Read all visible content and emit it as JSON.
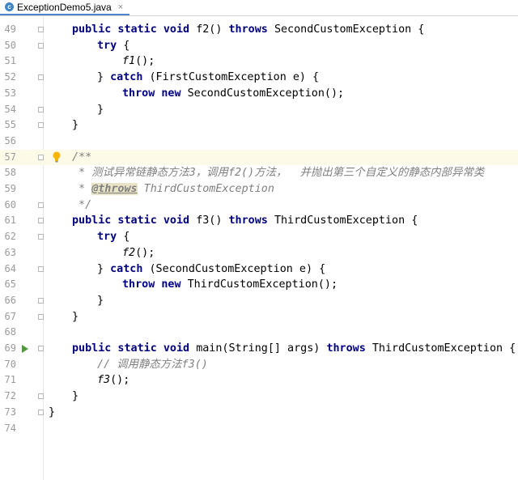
{
  "tab": {
    "icon": "java-class-icon",
    "icon_letter": "c",
    "title": "ExceptionDemo5.java",
    "close": "×"
  },
  "lines": [
    {
      "n": "49",
      "indent": 1,
      "parts": [
        [
          "kw",
          "public static void "
        ],
        [
          "",
          "f2() "
        ],
        [
          "kw",
          "throws "
        ],
        [
          "",
          "SecondCustomException {"
        ]
      ]
    },
    {
      "n": "50",
      "indent": 2,
      "parts": [
        [
          "kw",
          "try "
        ],
        [
          "",
          "{"
        ]
      ]
    },
    {
      "n": "51",
      "indent": 3,
      "parts": [
        [
          "it",
          "f1"
        ],
        [
          "",
          "();"
        ]
      ]
    },
    {
      "n": "52",
      "indent": 2,
      "parts": [
        [
          "",
          "} "
        ],
        [
          "kw",
          "catch "
        ],
        [
          "",
          "(FirstCustomException e) {"
        ]
      ]
    },
    {
      "n": "53",
      "indent": 3,
      "parts": [
        [
          "kw",
          "throw new "
        ],
        [
          "",
          "SecondCustomException();"
        ]
      ]
    },
    {
      "n": "54",
      "indent": 2,
      "parts": [
        [
          "",
          "}"
        ]
      ]
    },
    {
      "n": "55",
      "indent": 1,
      "parts": [
        [
          "",
          "}"
        ]
      ]
    },
    {
      "n": "56",
      "indent": 0,
      "parts": []
    },
    {
      "n": "57",
      "indent": 1,
      "current": true,
      "parts": [
        [
          "cm",
          "/**"
        ]
      ]
    },
    {
      "n": "58",
      "indent": 1,
      "parts": [
        [
          "cm",
          " * 测试异常链静态方法3，调用"
        ],
        [
          "cm",
          "f2()"
        ],
        [
          "cm",
          "方法，  并抛出第三个自定义的静态内部异常类"
        ]
      ]
    },
    {
      "n": "59",
      "indent": 1,
      "parts": [
        [
          "cm",
          " * "
        ],
        [
          "tag",
          "@throws"
        ],
        [
          "cm",
          " ThirdCustomException"
        ]
      ]
    },
    {
      "n": "60",
      "indent": 1,
      "parts": [
        [
          "cm",
          " */"
        ]
      ]
    },
    {
      "n": "61",
      "indent": 1,
      "parts": [
        [
          "kw",
          "public static void "
        ],
        [
          "",
          "f3() "
        ],
        [
          "kw",
          "throws "
        ],
        [
          "",
          "ThirdCustomException {"
        ]
      ]
    },
    {
      "n": "62",
      "indent": 2,
      "parts": [
        [
          "kw",
          "try "
        ],
        [
          "",
          "{"
        ]
      ]
    },
    {
      "n": "63",
      "indent": 3,
      "parts": [
        [
          "it",
          "f2"
        ],
        [
          "",
          "();"
        ]
      ]
    },
    {
      "n": "64",
      "indent": 2,
      "parts": [
        [
          "",
          "} "
        ],
        [
          "kw",
          "catch "
        ],
        [
          "",
          "(SecondCustomException e) {"
        ]
      ]
    },
    {
      "n": "65",
      "indent": 3,
      "parts": [
        [
          "kw",
          "throw new "
        ],
        [
          "",
          "ThirdCustomException();"
        ]
      ]
    },
    {
      "n": "66",
      "indent": 2,
      "parts": [
        [
          "",
          "}"
        ]
      ]
    },
    {
      "n": "67",
      "indent": 1,
      "parts": [
        [
          "",
          "}"
        ]
      ]
    },
    {
      "n": "68",
      "indent": 0,
      "parts": []
    },
    {
      "n": "69",
      "indent": 1,
      "run": true,
      "parts": [
        [
          "kw",
          "public static void "
        ],
        [
          "",
          "main(String[] args) "
        ],
        [
          "kw",
          "throws "
        ],
        [
          "",
          "ThirdCustomException {"
        ]
      ]
    },
    {
      "n": "70",
      "indent": 2,
      "parts": [
        [
          "cm",
          "// 调用静态方法f3()"
        ]
      ]
    },
    {
      "n": "71",
      "indent": 2,
      "parts": [
        [
          "it",
          "f3"
        ],
        [
          "",
          "();"
        ]
      ]
    },
    {
      "n": "72",
      "indent": 1,
      "parts": [
        [
          "",
          "}"
        ]
      ]
    },
    {
      "n": "73",
      "indent": 0,
      "parts": [
        [
          "",
          "}"
        ]
      ]
    },
    {
      "n": "74",
      "indent": 0,
      "parts": []
    }
  ],
  "fold_lines": [
    "49",
    "50",
    "52",
    "54",
    "55",
    "57",
    "60",
    "61",
    "62",
    "64",
    "66",
    "67",
    "69",
    "72",
    "73"
  ],
  "colors": {
    "keyword": "#000080",
    "comment": "#808080",
    "current_line": "#fdfbe7",
    "line_number": "#9a9a9a"
  }
}
